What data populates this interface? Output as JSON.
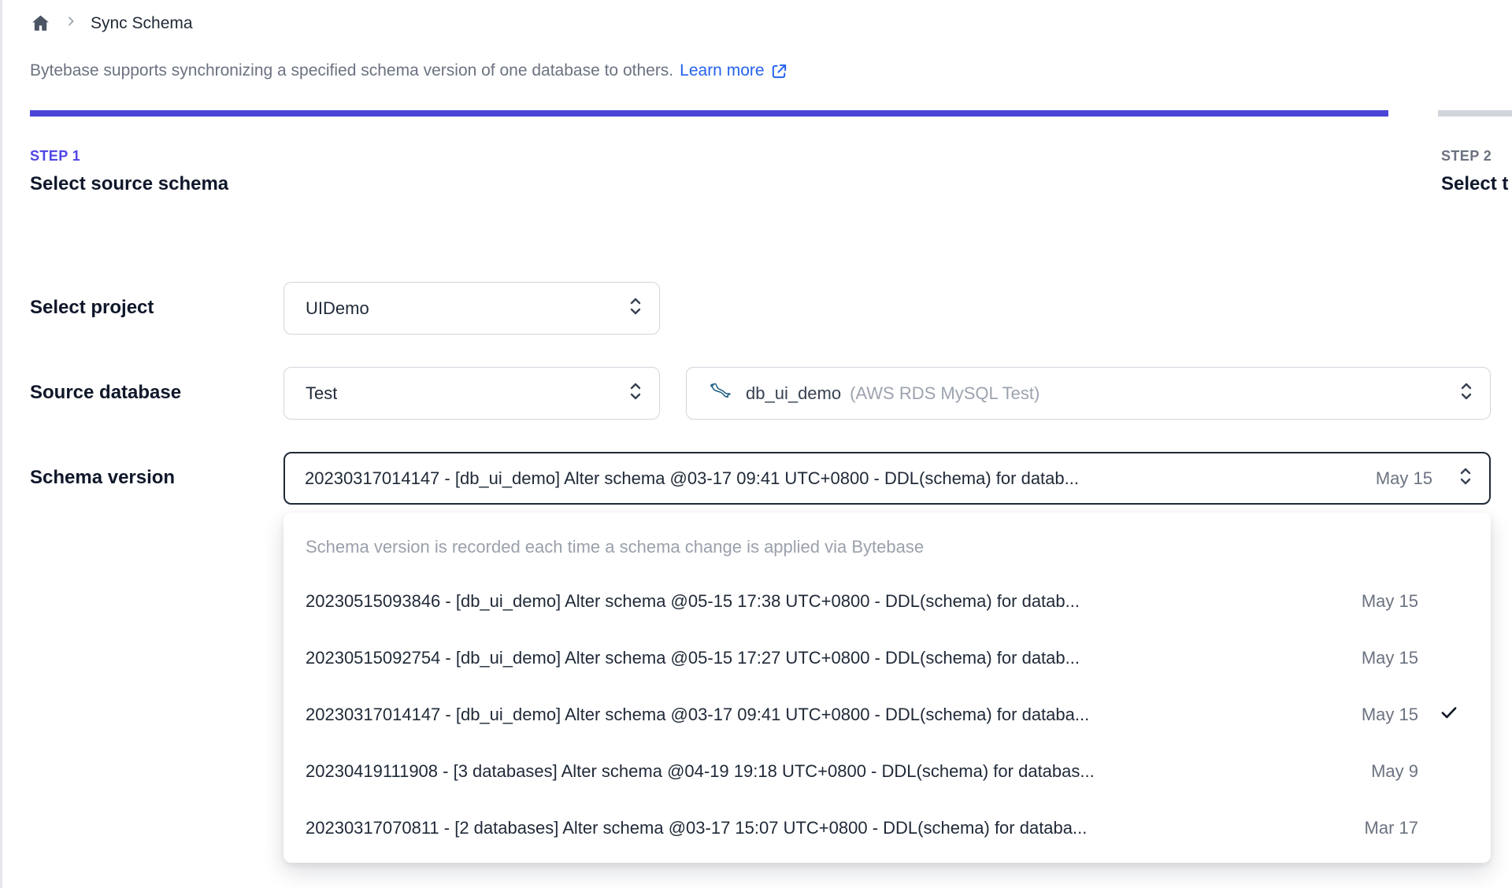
{
  "breadcrumb": {
    "page_title": "Sync Schema"
  },
  "description": {
    "text": "Bytebase supports synchronizing a specified schema version of one database to others.",
    "link_label": "Learn more"
  },
  "steps": [
    {
      "eyebrow": "STEP 1",
      "title": "Select source schema",
      "active": true
    },
    {
      "eyebrow": "STEP 2",
      "title": "Select t",
      "active": false
    }
  ],
  "form": {
    "project": {
      "label": "Select project",
      "value": "UIDemo"
    },
    "source_database": {
      "label": "Source database",
      "environment_value": "Test",
      "database_name": "db_ui_demo",
      "database_detail": "(AWS RDS MySQL Test)",
      "engine_icon": "mysql-dolphin-icon"
    },
    "schema_version": {
      "label": "Schema version",
      "value": "20230317014147 - [db_ui_demo] Alter schema @03-17 09:41 UTC+0800 - DDL(schema) for datab...",
      "date": "May 15"
    }
  },
  "dropdown": {
    "hint": "Schema version is recorded each time a schema change is applied via Bytebase",
    "options": [
      {
        "text": "20230515093846 - [db_ui_demo] Alter schema @05-15 17:38 UTC+0800 - DDL(schema) for datab...",
        "date": "May 15",
        "selected": false
      },
      {
        "text": "20230515092754 - [db_ui_demo] Alter schema @05-15 17:27 UTC+0800 - DDL(schema) for datab...",
        "date": "May 15",
        "selected": false
      },
      {
        "text": "20230317014147 - [db_ui_demo] Alter schema @03-17 09:41 UTC+0800 - DDL(schema) for databa...",
        "date": "May 15",
        "selected": true
      },
      {
        "text": "20230419111908 - [3 databases] Alter schema @04-19 19:18 UTC+0800 - DDL(schema) for databas...",
        "date": "May 9",
        "selected": false
      },
      {
        "text": "20230317070811 - [2 databases] Alter schema @03-17 15:07 UTC+0800 - DDL(schema) for databa...",
        "date": "Mar 17",
        "selected": false
      }
    ]
  },
  "colors": {
    "accent_indigo": "#4a44d6",
    "step_active": "#4f46e5",
    "link_blue": "#2563eb",
    "bar_inactive": "#d1d5db",
    "text_muted": "#6b7280"
  }
}
